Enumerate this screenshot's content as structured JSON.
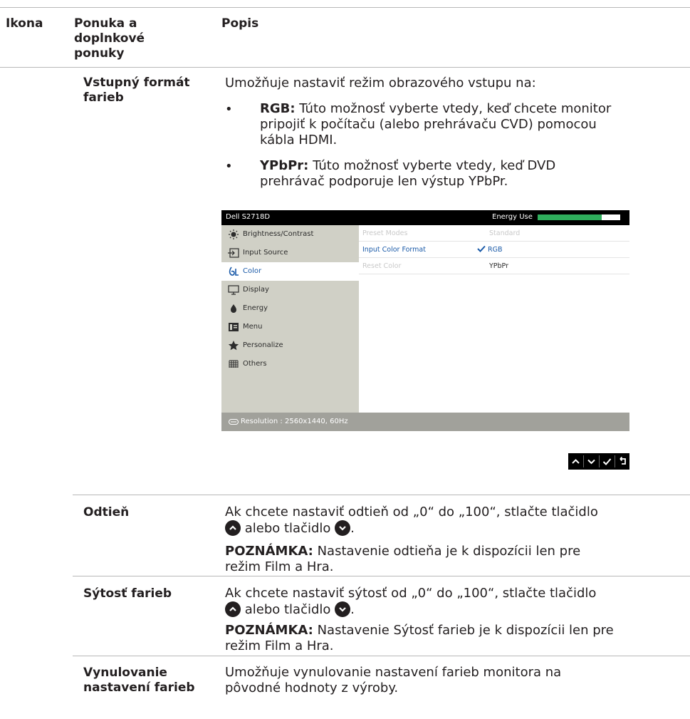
{
  "header": {
    "col1": "Ikona",
    "col2": [
      "Ponuka a",
      "doplnkové",
      "ponuky"
    ],
    "col3": "Popis"
  },
  "rows": {
    "input_color": {
      "name": [
        "Vstupný formát",
        "farieb"
      ],
      "intro": "Umožňuje nastaviť režim obrazového vstupu na:",
      "bullets": [
        {
          "term": "RGB:",
          "lines": [
            " Túto možnosť vyberte vtedy, keď chcete monitor",
            "pripojiť k počítaču (alebo prehrávaču CVD) pomocou",
            "kábla HDMI."
          ]
        },
        {
          "term": "YPbPr:",
          "lines": [
            " Túto možnosť vyberte vtedy, keď DVD",
            "prehrávač podporuje len výstup YPbPr."
          ]
        }
      ]
    },
    "hue": {
      "name": "Odtieň",
      "line1": "Ak chcete nastaviť odtieň od „0“ do „100“, stlačte tlačidlo",
      "line2_mid": " alebo tlačidlo ",
      "line2_end": ".",
      "note_label": "POZNÁMKA:",
      "note_text": " Nastavenie odtieňa je k dispozícii len pre",
      "note_line2": "režim Film a Hra."
    },
    "saturation": {
      "name": "Sýtosť farieb",
      "line1": "Ak chcete nastaviť sýtosť od „0“ do „100“, stlačte tlačidlo",
      "line2_mid": " alebo tlačidlo ",
      "line2_end": ".",
      "note_label": "POZNÁMKA:",
      "note_text": " Nastavenie Sýtosť farieb je k dispozícii len pre",
      "note_line2": "režim Film a Hra."
    },
    "reset": {
      "name": [
        "Vynulovanie",
        "nastavení farieb"
      ],
      "lines": [
        "Umožňuje vynulovanie nastavení farieb monitora na",
        "pôvodné hodnoty z výroby."
      ]
    }
  },
  "osd": {
    "model": "Dell S2718D",
    "energy_label": "Energy Use",
    "energy_level": 0.78,
    "menu": [
      {
        "label": "Brightness/Contrast",
        "icon": "brightness-icon"
      },
      {
        "label": "Input Source",
        "icon": "input-source-icon"
      },
      {
        "label": "Color",
        "icon": "color-icon"
      },
      {
        "label": "Display",
        "icon": "display-icon"
      },
      {
        "label": "Energy",
        "icon": "energy-icon"
      },
      {
        "label": "Menu",
        "icon": "menu-icon"
      },
      {
        "label": "Personalize",
        "icon": "star-icon"
      },
      {
        "label": "Others",
        "icon": "others-icon"
      }
    ],
    "selected": "Color",
    "options": [
      {
        "label": "Preset Modes",
        "value": "Standard",
        "state": "disabled"
      },
      {
        "label": "Input Color Format",
        "value": "RGB",
        "state": "active",
        "checked": true
      },
      {
        "label": "Reset Color",
        "value": "YPbPr",
        "state": "disabled"
      }
    ],
    "resolution": "Resolution : 2560x1440, 60Hz",
    "nav_buttons": [
      "up-icon",
      "down-icon",
      "check-icon",
      "back-icon"
    ]
  },
  "colors": {
    "text": "#231f20",
    "osd_menu_bg": "#d0d0c6",
    "osd_accent": "#1a5aa8",
    "energy_bar": "#2fae5c",
    "osd_bottom": "#a1a19b"
  }
}
